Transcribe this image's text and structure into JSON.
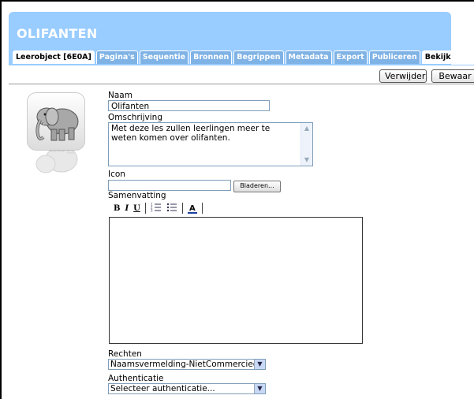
{
  "header": {
    "title": "OLIFANTEN"
  },
  "tabs": [
    {
      "label": "Leerobject [6E0A]"
    },
    {
      "label": "Pagina's"
    },
    {
      "label": "Sequentie"
    },
    {
      "label": "Bronnen"
    },
    {
      "label": "Begrippen"
    },
    {
      "label": "Metadata"
    },
    {
      "label": "Export"
    },
    {
      "label": "Publiceren"
    },
    {
      "label": "Bekijk"
    }
  ],
  "actions": {
    "delete_label": "Verwijder",
    "save_label": "Bewaar"
  },
  "form": {
    "name_label": "Naam",
    "name_value": "Olifanten",
    "description_label": "Omschrijving",
    "description_value": "Met deze les zullen leerlingen meer te weten komen over olifanten.",
    "icon_label": "Icon",
    "browse_label": "Bladeren...",
    "summary_label": "Samenvatting",
    "rights_label": "Rechten",
    "rights_value": "Naamsvermelding-NietCommercieel-",
    "auth_label": "Authenticatie",
    "auth_value": "Selecteer authenticatie..."
  },
  "editor_toolbar": {
    "bold": "B",
    "italic": "I",
    "underline": "U",
    "font_color": "A"
  },
  "icons": [
    "elephant-image",
    "ordered-list-icon",
    "unordered-list-icon",
    "font-color-icon",
    "dropdown-arrow-icon"
  ]
}
